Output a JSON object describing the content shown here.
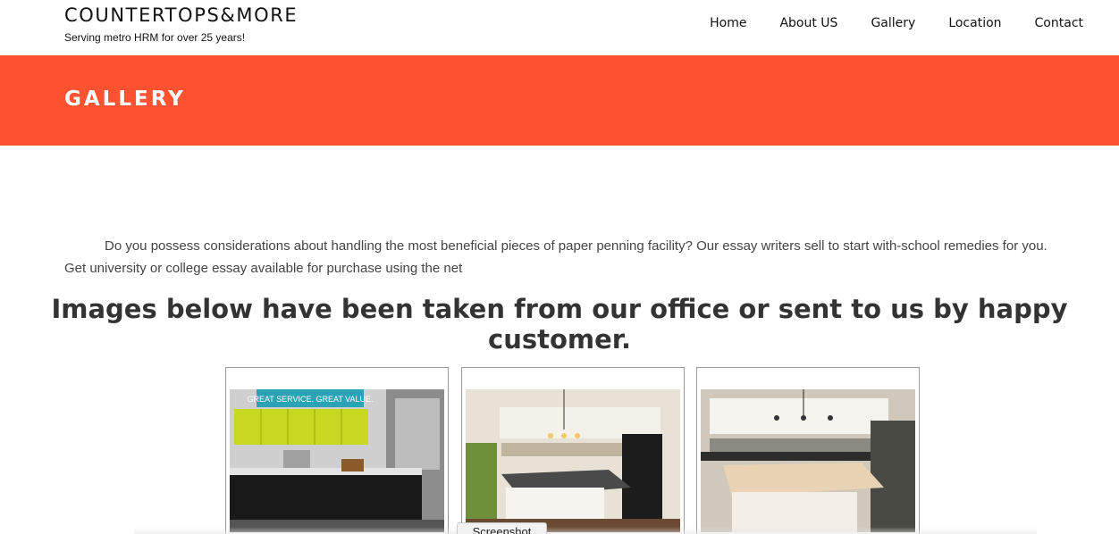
{
  "brand": {
    "title": "COUNTERTOPS&MORE",
    "tagline": "Serving metro HRM for over 25 years!"
  },
  "nav": {
    "items": [
      {
        "label": "Home"
      },
      {
        "label": "About US"
      },
      {
        "label": "Gallery"
      },
      {
        "label": "Location"
      },
      {
        "label": "Contact"
      }
    ]
  },
  "banner": {
    "title": "GALLERY",
    "color": "#ff5230"
  },
  "intro": {
    "text": "Do you possess considerations about handling the most beneficial pieces of paper penning facility? Our essay writers sell to start with-school remedies for you. Get university or college essay available for purchase using the net"
  },
  "gallery": {
    "heading": "Images below have been taken from our office or sent to us by happy customer.",
    "images": [
      {
        "sign_text": "GREAT SERVICE. GREAT VALUE."
      },
      {},
      {}
    ]
  },
  "tooltip": {
    "label": "Screenshot"
  }
}
